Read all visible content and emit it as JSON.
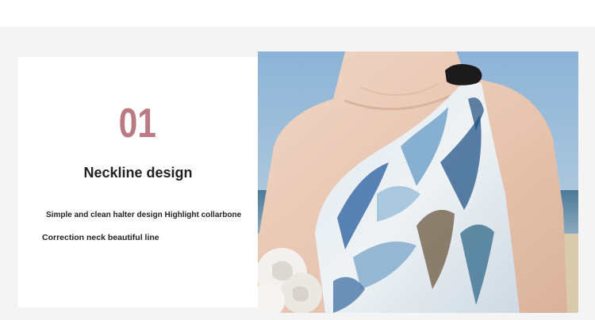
{
  "feature": {
    "number": "01",
    "title": "Neckline design",
    "description_line1": "Simple and clean halter design Highlight collarbone",
    "description_line2": "Correction neck beautiful line"
  },
  "colors": {
    "number": "#b97a82",
    "text": "#222222",
    "band": "#f4f4f4",
    "card": "#ffffff"
  },
  "photo": {
    "subject": "model-one-shoulder-dress-beach"
  }
}
